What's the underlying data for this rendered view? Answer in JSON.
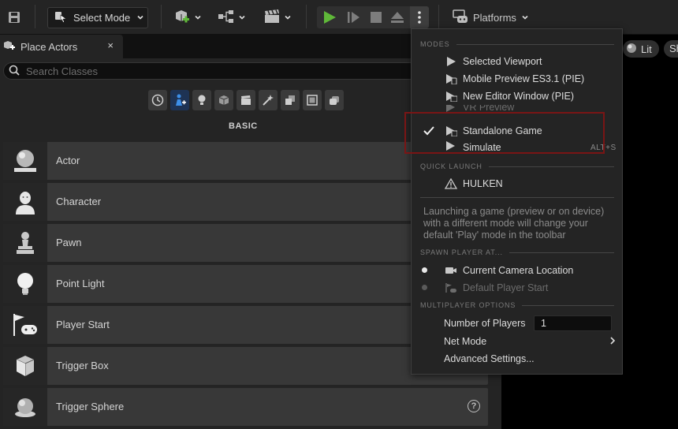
{
  "toolbar": {
    "select_mode_label": "Select Mode",
    "platforms_label": "Platforms"
  },
  "tab": {
    "title": "Place Actors",
    "close": "×"
  },
  "search": {
    "placeholder": "Search Classes"
  },
  "categories": [
    "recent-icon",
    "basic-icon",
    "lights-icon",
    "shapes-icon",
    "cinematic-icon",
    "visual-effects-icon",
    "volumes-icon",
    "all-classes-icon",
    "misc-icon"
  ],
  "section_title": "BASIC",
  "actors": [
    {
      "label": "Actor"
    },
    {
      "label": "Character"
    },
    {
      "label": "Pawn"
    },
    {
      "label": "Point Light"
    },
    {
      "label": "Player Start"
    },
    {
      "label": "Trigger Box"
    },
    {
      "label": "Trigger Sphere"
    }
  ],
  "help_glyph": "?",
  "viewport": {
    "lit_label": "Lit",
    "sh_label": "Sh"
  },
  "menu": {
    "modes_header": "MODES",
    "modes": [
      {
        "label": "Selected Viewport"
      },
      {
        "label": "Mobile Preview ES3.1 (PIE)"
      },
      {
        "label": "New Editor Window (PIE)"
      },
      {
        "label": "VR Preview"
      },
      {
        "label": "Standalone Game"
      },
      {
        "label": "Simulate",
        "shortcut": "ALT+S"
      }
    ],
    "quick_launch_header": "QUICK LAUNCH",
    "quick_launch_item": "HULKEN",
    "description": "Launching a game (preview or on device) with a different mode will change your default 'Play' mode in the toolbar",
    "spawn_header": "SPAWN PLAYER AT...",
    "spawn_options": [
      {
        "label": "Current Camera Location"
      },
      {
        "label": "Default Player Start"
      }
    ],
    "multiplayer_header": "MULTIPLAYER OPTIONS",
    "num_players_label": "Number of Players",
    "num_players_value": "1",
    "net_mode_label": "Net Mode",
    "advanced_label": "Advanced Settings..."
  },
  "colors": {
    "accent_play": "#5fb839",
    "highlight_box": "#7a1515",
    "active_category": "#1e3354"
  }
}
